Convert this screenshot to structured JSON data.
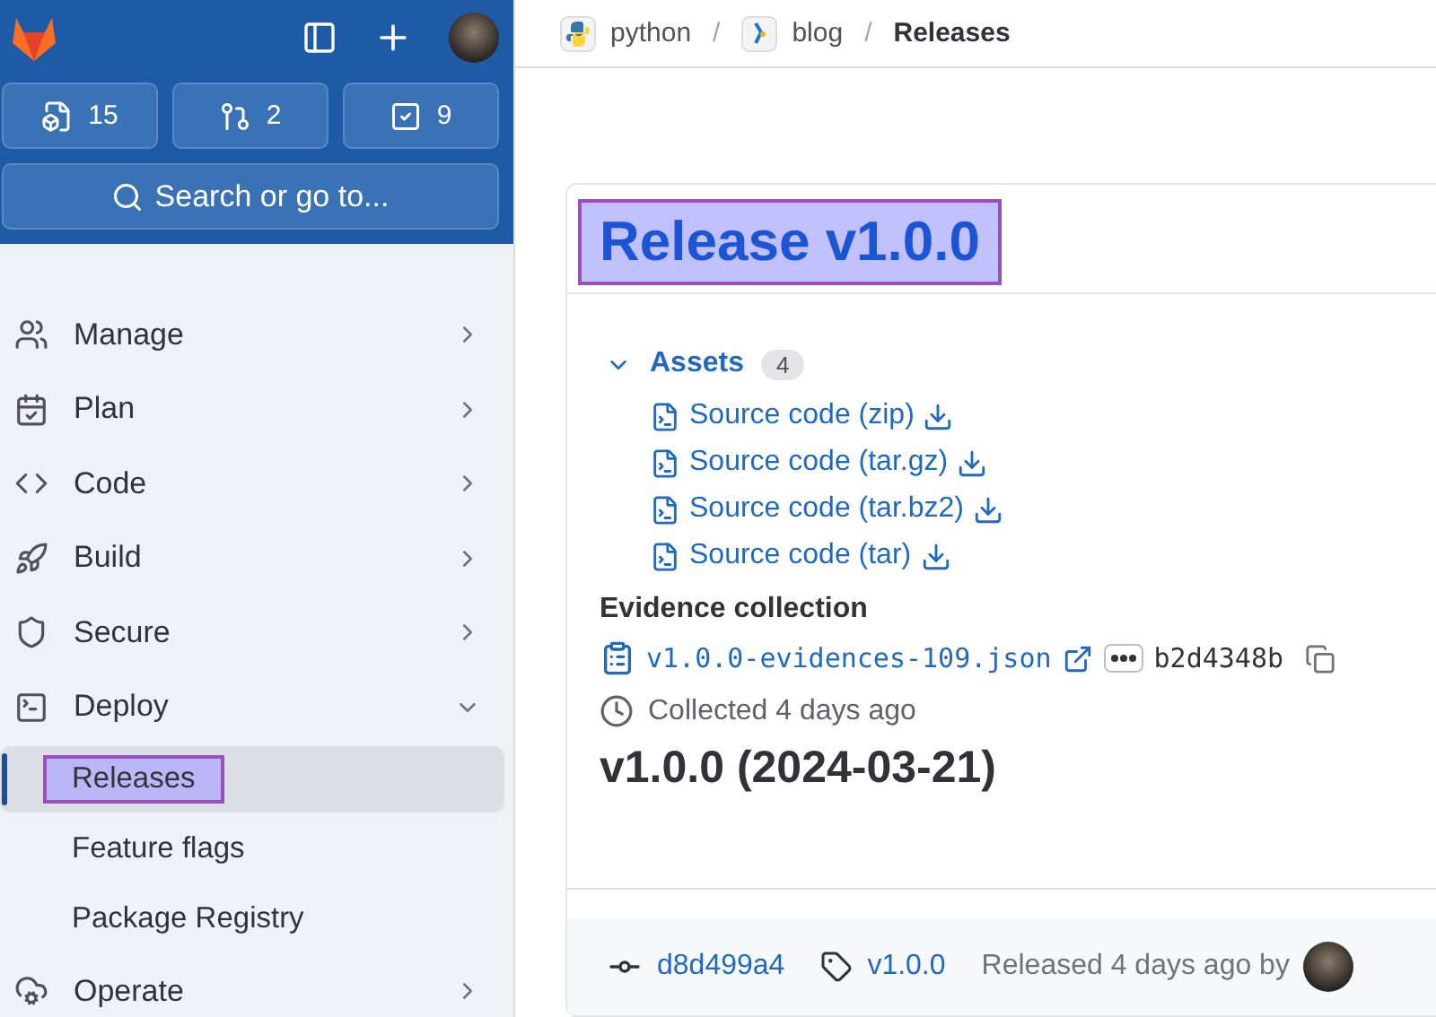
{
  "sidebar": {
    "counters": [
      {
        "kind": "issues",
        "count": "15"
      },
      {
        "kind": "merge",
        "count": "2"
      },
      {
        "kind": "todos",
        "count": "9"
      }
    ],
    "search": {
      "label": "Search or go to..."
    },
    "nav": [
      {
        "kind": "manage",
        "label": "Manage",
        "expanded": false
      },
      {
        "kind": "plan",
        "label": "Plan",
        "expanded": false
      },
      {
        "kind": "code",
        "label": "Code",
        "expanded": false
      },
      {
        "kind": "build",
        "label": "Build",
        "expanded": false
      },
      {
        "kind": "secure",
        "label": "Secure",
        "expanded": false
      },
      {
        "kind": "deploy",
        "label": "Deploy",
        "expanded": true,
        "children": [
          {
            "label": "Releases",
            "selected": true,
            "highlighted": true
          },
          {
            "label": "Feature flags",
            "selected": false,
            "highlighted": false
          },
          {
            "label": "Package Registry",
            "selected": false,
            "highlighted": false
          }
        ]
      },
      {
        "kind": "operate",
        "label": "Operate",
        "expanded": false
      }
    ]
  },
  "breadcrumbs": [
    {
      "kind": "python",
      "label": "python"
    },
    {
      "kind": "blog",
      "label": "blog",
      "separator": "/"
    },
    {
      "kind": "current",
      "label": "Releases",
      "separator": "/"
    }
  ],
  "release": {
    "title": "Release v1.0.0",
    "title_highlighted": true,
    "assets": {
      "label": "Assets",
      "count": "4",
      "expanded": true,
      "items": [
        "Source code (zip)",
        "Source code (tar.gz)",
        "Source code (tar.bz2)",
        "Source code (tar)"
      ]
    },
    "evidence": {
      "heading": "Evidence collection",
      "file": "v1.0.0-evidences-109.json",
      "sha": "b2d4348b",
      "collected": "Collected 4 days ago"
    },
    "notes_heading": "v1.0.0 (2024-03-21)",
    "footer": {
      "commit": "d8d499a4",
      "tag": "v1.0.0",
      "released": "Released 4 days ago by"
    }
  }
}
